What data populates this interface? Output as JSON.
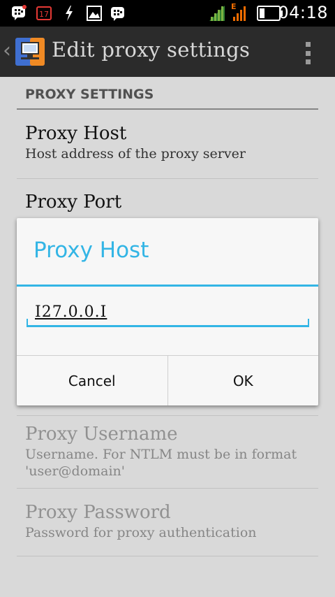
{
  "status_bar": {
    "time": "04:18",
    "icons": [
      "bbm-icon",
      "calendar-17-icon",
      "usb-lightning-icon",
      "gallery-icon",
      "bbm-icon-2",
      "signal-icon",
      "signal-edge-icon",
      "battery-icon"
    ],
    "calendar_day": "17",
    "network_label": "E"
  },
  "action_bar": {
    "title": "Edit proxy settings"
  },
  "settings": {
    "section_header": "PROXY SETTINGS",
    "items": [
      {
        "title": "Proxy Host",
        "summary": "Host address of the proxy server"
      },
      {
        "title": "Proxy Port",
        "summary": ""
      },
      {
        "title": "Proxy Username",
        "summary": "Username. For NTLM must be in format 'user@domain'"
      },
      {
        "title": "Proxy Password",
        "summary": "Password for proxy authentication"
      }
    ]
  },
  "dialog": {
    "title": "Proxy Host",
    "input_value": "I27.0.0.I",
    "cancel_label": "Cancel",
    "ok_label": "OK"
  },
  "colors": {
    "accent": "#33b5e5",
    "action_bar": "#2b2b2b",
    "status_bar": "#000000"
  }
}
